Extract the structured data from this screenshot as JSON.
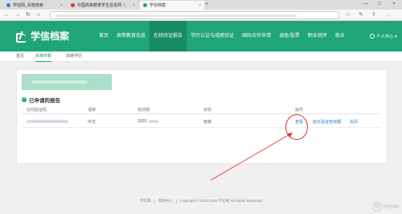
{
  "browser": {
    "tabs": [
      {
        "label": "学信网_百度搜索",
        "favicon_color": "#3b7ddd"
      },
      {
        "label": "中国高等教育学生信息网（",
        "favicon_color": "#d0432f"
      },
      {
        "label": "学信档案",
        "favicon_color": "#20a47a"
      }
    ],
    "tab_close": "×",
    "new_tab": "+",
    "window_controls": [
      "—",
      "□",
      "×"
    ],
    "nav": {
      "back": "←",
      "forward": "→",
      "reload": "↻",
      "home": "⌂"
    },
    "toolbar_icons": [
      "☆",
      "✎",
      "⇪",
      "…"
    ]
  },
  "header": {
    "logo_text": "学信档案",
    "nav_items": [
      "首页",
      "高等教育信息",
      "在线验证报告",
      "学历认证与成绩验证",
      "国际合作申请",
      "调查/投票",
      "职业测评",
      "就业"
    ],
    "active_index": 2,
    "user_center": "个人中心 ▾"
  },
  "subnav": {
    "items": [
      "首页",
      "高等学籍",
      "高等学历"
    ],
    "active_index": 1
  },
  "section": {
    "title": "已申请的报告"
  },
  "table": {
    "headers": [
      "在线验证码",
      "语种",
      "有效期",
      "状态",
      "操作"
    ],
    "row": {
      "lang": "中文",
      "validity_prefix": "2020.",
      "status": "有效",
      "actions": [
        "查看",
        "延长验证有效期",
        "关闭"
      ]
    }
  },
  "footer": {
    "items": [
      "学信网",
      "|",
      "帮助中心",
      "|",
      "Copyright © 2003-2020 学信网 All Rights Reserved"
    ]
  },
  "watermark": {
    "mark": "经",
    "text": "jingyan"
  },
  "colors": {
    "brand_green": "#20a47a",
    "annotation_red": "#e0332b",
    "link_blue": "#2a7ad0"
  }
}
